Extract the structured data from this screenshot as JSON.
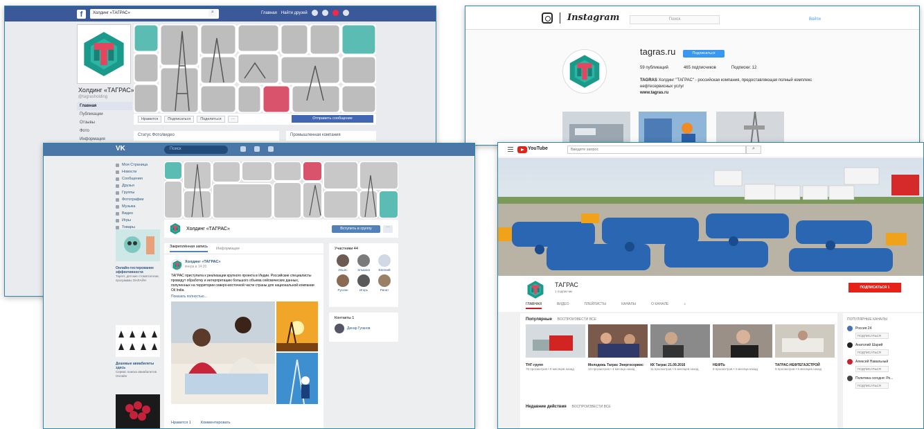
{
  "facebook": {
    "search_value": "Холдинг «ТАГРАС»",
    "nav": [
      "Главная",
      "Найти друзей"
    ],
    "page_name": "Холдинг «ТАГРАС»",
    "page_handle": "@tagrasholding",
    "leftnav": [
      "Главная",
      "Публикации",
      "Отзывы",
      "Фото",
      "Информация"
    ],
    "actions": [
      "Нравится",
      "Подписаться",
      "Поделиться",
      "···"
    ],
    "send_message": "Отправить сообщение",
    "composer": "Статус   Фото/видео",
    "sidebox": "Промышленная компания"
  },
  "instagram": {
    "wordmark": "Instagram",
    "search_placeholder": "Поиск",
    "login": "Войти",
    "username": "tagras.ru",
    "follow": "Подписаться",
    "stats": [
      "59 публикаций",
      "465 подписчиков",
      "Подписки: 12"
    ],
    "bio_name": "TAGRAS",
    "bio_text": "Холдинг \"ТАГРАС\" - российская компания, предоставляющая полный комплекс нефтесервисных услуг",
    "bio_link": "www.tagras.ru"
  },
  "vk": {
    "logo": "VK",
    "search_placeholder": "Поиск",
    "menu": [
      "Моя Страница",
      "Новости",
      "Сообщения",
      "Друзья",
      "Группы",
      "Фотографии",
      "Музыка",
      "Видео",
      "Игры",
      "Товары"
    ],
    "group_name": "Холдинг «ТАГРАС»",
    "join": "Вступить в группу",
    "more": "···",
    "tabs": [
      "Закреплённая запись",
      "Информация"
    ],
    "post_author": "Холдинг «ТАГРАС»",
    "post_time": "вчера в 14:20",
    "post_text": "ТАГРАС приступила к реализации крупного проекта в Индии. Российские специалисты проведут обработку и интерпретацию большого объема сейсмических данных, полученных на территории северо-восточной части страны для национальной компании Oil India.",
    "show_more": "Показать полностью...",
    "likes": [
      "Нравится 1",
      "Комментировать"
    ],
    "members_title": "Участники 44",
    "members": [
      "Ильяс",
      "Эльвина",
      "Евгений",
      "Руслан",
      "Игорь",
      "Ринат"
    ],
    "contacts_title": "Контакты 1",
    "contact": "Динар Гуганов",
    "ads": [
      {
        "title": "Онлайн-тестирование эффективности",
        "text": "Таргет, детские стоматологии, программы ОНЛАЙН"
      },
      {
        "title": "Дешевые авиабилеты здесь",
        "text": "Сервис поиска авиабилетов Онлайн"
      }
    ]
  },
  "youtube": {
    "logo_text": "YouTube",
    "search_placeholder": "Введите запрос",
    "channel_name": "ТАГРАС",
    "channel_subs": "1 подписчик",
    "subscribe": "ПОДПИСАТЬСЯ 1",
    "tabs": [
      "ГЛАВНАЯ",
      "ВИДЕО",
      "ПЛЕЙЛИСТЫ",
      "КАНАЛЫ",
      "О КАНАЛЕ"
    ],
    "popular": "Популярные",
    "play_all": "ВОСПРОИЗВЕСТИ ВСЕ",
    "videos": [
      {
        "title": "ТНГ-групп",
        "meta": "75 просмотров • 6 месяцев назад",
        "dur": "0:53"
      },
      {
        "title": "Молодежь Таграс Энергосервис",
        "meta": "13 просмотров • 4 месяца назад",
        "dur": "0:47"
      },
      {
        "title": "КК Таграс 21.09.2016",
        "meta": "11 просмотров • 6 месяцев назад",
        "dur": "5:56"
      },
      {
        "title": "НЕФТЬ",
        "meta": "9 просмотров • 4 месяца назад",
        "dur": "10:04"
      },
      {
        "title": "ТАГРАС-НЕФТЕГАЗСТРОЙ",
        "meta": "9 просмотров • 6 месяцев назад",
        "dur": "2:17"
      }
    ],
    "recent": "Недавние действия",
    "recent_play": "ВОСПРОИЗВЕСТИ ВСЕ",
    "side_title": "ПОПУЛЯРНЫЕ КАНАЛЫ",
    "side_channels": [
      {
        "name": "Россия 24",
        "sub": "ПОДПИСАТЬСЯ"
      },
      {
        "name": "Анатолий Шарий",
        "sub": "ПОДПИСАТЬСЯ"
      },
      {
        "name": "Алексей Навальный",
        "sub": "ПОДПИСАТЬСЯ"
      },
      {
        "name": "Политика сегодня: Ро...",
        "sub": "ПОДПИСАТЬСЯ"
      }
    ]
  }
}
